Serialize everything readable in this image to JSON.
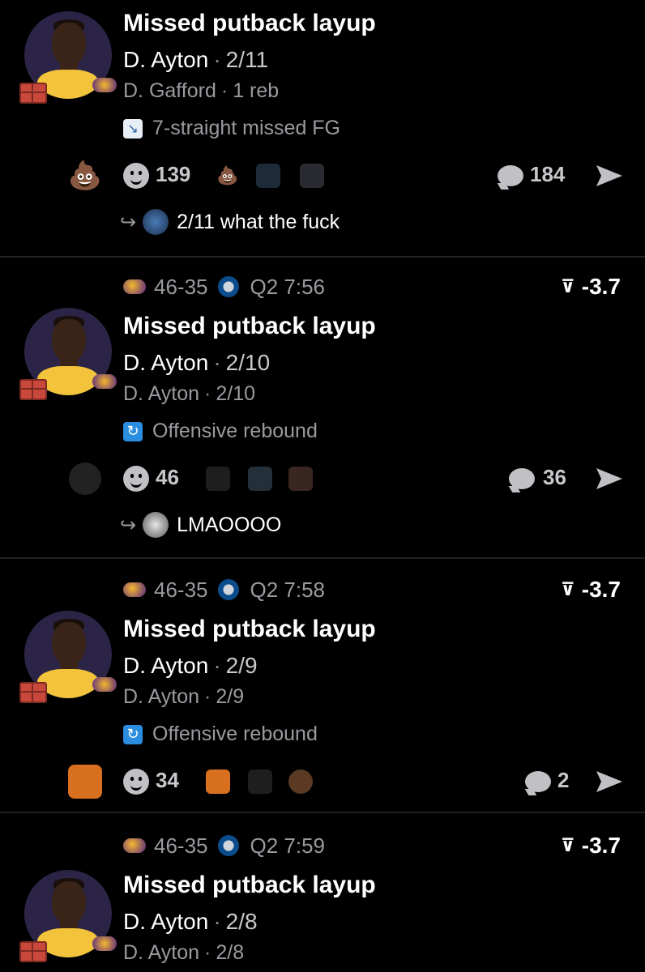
{
  "posts": [
    {
      "has_header": false,
      "title": "Missed putback layup",
      "player": "D. Ayton",
      "player_stat": "2/11",
      "secondary_player": "D. Gafford",
      "secondary_stat": "1 reb",
      "tag_icon": "chart-down-icon",
      "tag_text": "7-straight missed FG",
      "top_reaction": "poop-emoji",
      "reaction_count": "139",
      "comment_count": "184",
      "reply_text": "2/11 what the fuck"
    },
    {
      "has_header": true,
      "score": "46-35",
      "clock": "Q2 7:56",
      "spread": "-3.7",
      "title": "Missed putback layup",
      "player": "D. Ayton",
      "player_stat": "2/10",
      "secondary_player": "D. Ayton",
      "secondary_stat": "2/10",
      "tag_icon": "refresh-icon",
      "tag_text": "Offensive rebound",
      "top_reaction": "brooklyn-player-image",
      "reaction_count": "46",
      "comment_count": "36",
      "reply_text": "LMAOOOO"
    },
    {
      "has_header": true,
      "score": "46-35",
      "clock": "Q2 7:58",
      "spread": "-3.7",
      "title": "Missed putback layup",
      "player": "D. Ayton",
      "player_stat": "2/9",
      "secondary_player": "D. Ayton",
      "secondary_stat": "2/9",
      "tag_icon": "refresh-icon",
      "tag_text": "Offensive rebound",
      "top_reaction": "drake-image",
      "reaction_count": "34",
      "comment_count": "2"
    },
    {
      "has_header": true,
      "score": "46-35",
      "clock": "Q2 7:59",
      "spread": "-3.7",
      "title": "Missed putback layup",
      "player": "D. Ayton",
      "player_stat": "2/8",
      "secondary_player": "D. Ayton",
      "secondary_stat": "2/8"
    }
  ],
  "colors": {
    "background": "#000000",
    "muted_text": "#9a9aa0",
    "divider": "#222222",
    "lakers_gold": "#f5b82e",
    "lakers_purple": "#552583",
    "refresh_blue": "#2b8de0"
  }
}
